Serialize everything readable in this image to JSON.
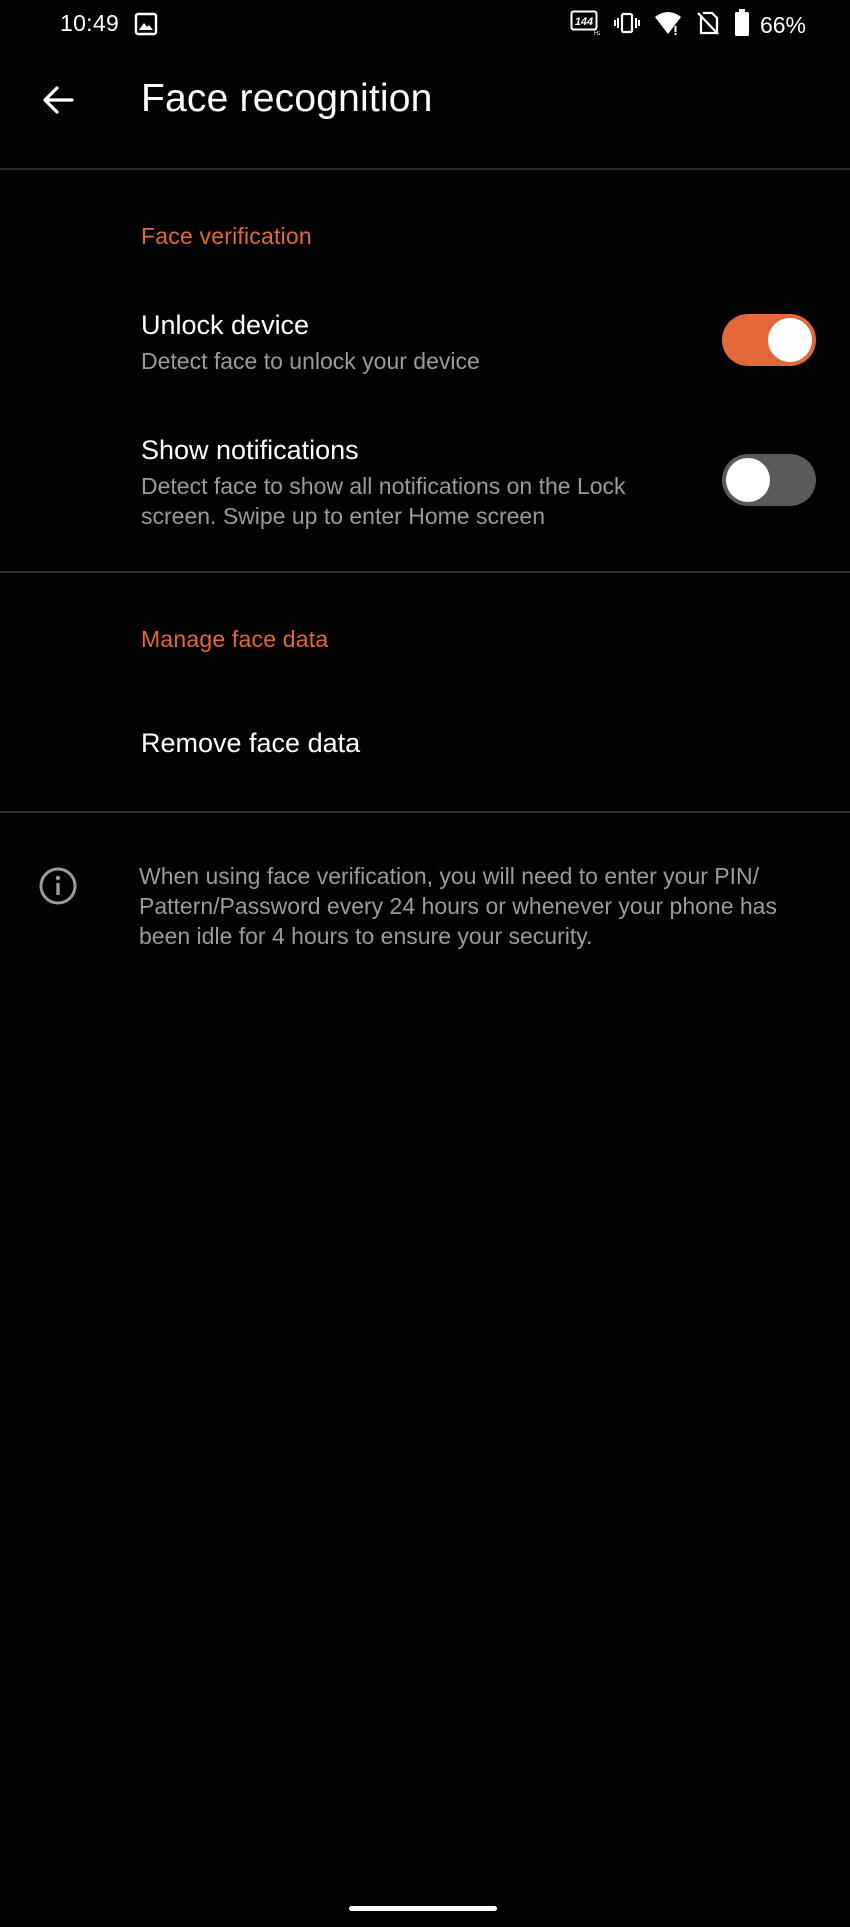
{
  "status_bar": {
    "time": "10:49",
    "battery_percent": "66%",
    "refresh_rate_label": "144",
    "icons": [
      "image-icon",
      "refresh-rate-icon",
      "vibrate-icon",
      "wifi-icon",
      "no-sim-icon",
      "battery-icon"
    ]
  },
  "app_bar": {
    "title": "Face recognition",
    "back_icon": "arrow-back-icon"
  },
  "sections": {
    "face_verification": {
      "header": "Face verification",
      "unlock_device": {
        "title": "Unlock device",
        "summary": "Detect face to unlock your device",
        "enabled": true
      },
      "show_notifications": {
        "title": "Show notifications",
        "summary": "Detect face to show all notifications on the Lock screen. Swipe up to enter Home screen",
        "enabled": false
      }
    },
    "manage_face_data": {
      "header": "Manage face data",
      "remove_face_data": {
        "title": "Remove face data"
      }
    }
  },
  "info": {
    "icon": "info-icon",
    "text": "When using face verification, you will need to enter your PIN/ Pattern/Password every 24 hours or whenever your phone has been idle for 4 hours to ensure your security."
  },
  "colors": {
    "accent": "#e2683a",
    "background": "#030203",
    "secondary_text": "#9a9a9a",
    "toggle_off": "#5a5a5a"
  }
}
